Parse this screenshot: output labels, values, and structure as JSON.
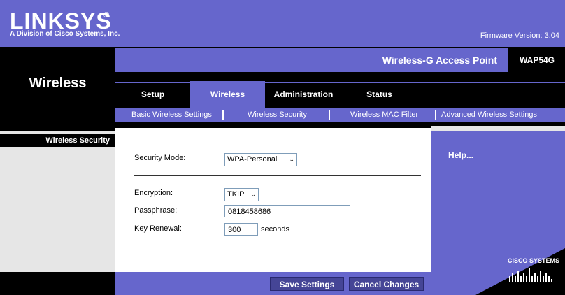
{
  "brand": {
    "logo": "LINKSYS",
    "registered": "®",
    "subtitle": "A Division of Cisco Systems, Inc."
  },
  "firmware": "Firmware Version: 3.04",
  "product": {
    "title": "Wireless-G Access Point",
    "model": "WAP54G"
  },
  "section_title": "Wireless",
  "tabs": [
    {
      "label": "Setup",
      "active": false
    },
    {
      "label": "Wireless",
      "active": true
    },
    {
      "label": "Administration",
      "active": false
    },
    {
      "label": "Status",
      "active": false
    }
  ],
  "subnav": [
    "Basic Wireless Settings",
    "Wireless Security",
    "Wireless MAC Filter",
    "Advanced Wireless Settings"
  ],
  "sidebar_label": "Wireless Security",
  "help": "Help...",
  "form": {
    "security_mode_label": "Security Mode:",
    "security_mode_value": "WPA-Personal",
    "encryption_label": "Encryption:",
    "encryption_value": "TKIP",
    "passphrase_label": "Passphrase:",
    "passphrase_value": "0818458686",
    "key_renewal_label": "Key Renewal:",
    "key_renewal_value": "300",
    "key_renewal_unit": "seconds"
  },
  "buttons": {
    "save": "Save Settings",
    "cancel": "Cancel Changes"
  },
  "cisco": "CISCO SYSTEMS",
  "colors": {
    "accent": "#6666cc",
    "background": "#000000",
    "panel": "#ffffff"
  }
}
